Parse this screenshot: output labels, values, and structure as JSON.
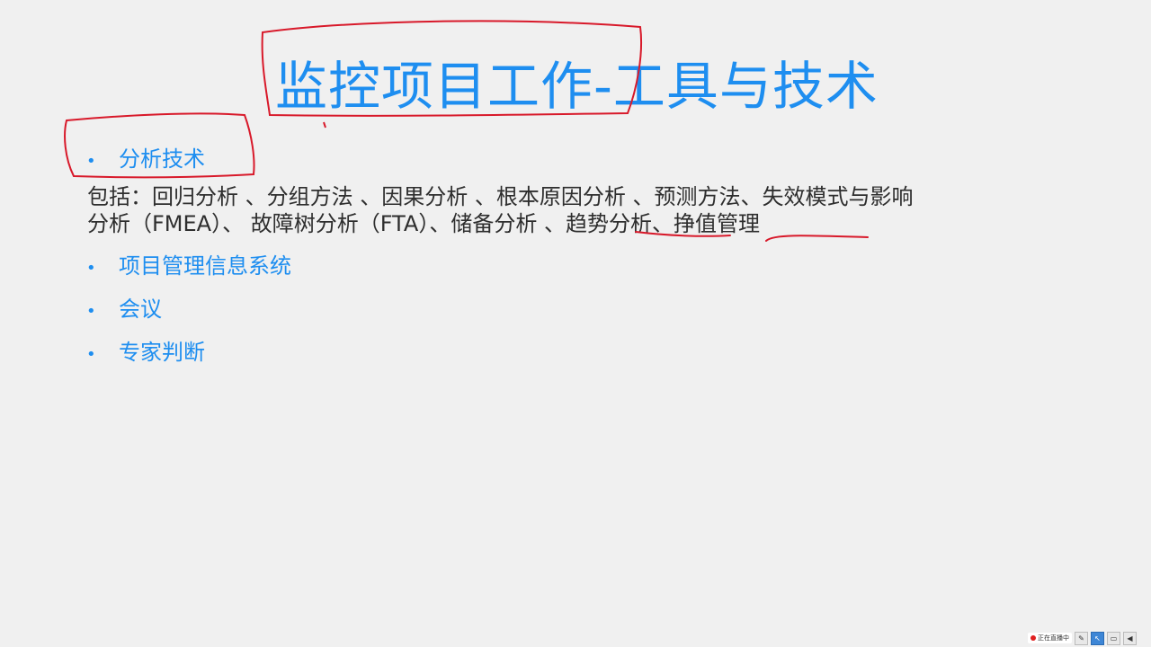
{
  "slide": {
    "title": "监控项目工作-工具与技术",
    "bullets": [
      {
        "marker": "•",
        "text": "分析技术"
      },
      {
        "marker": "•",
        "text": "项目管理信息系统"
      },
      {
        "marker": "•",
        "text": "会议"
      },
      {
        "marker": "•",
        "text": "专家判断"
      }
    ],
    "body_line1": "包括：回归分析 、分组方法 、因果分析 、根本原因分析 、预测方法、失效模式与影响",
    "body_line2": "分析（FMEA）、 故障树分析（FTA）、储备分析 、趋势分析、挣值管理"
  },
  "colors": {
    "accent": "#1e8ef0",
    "body_text": "#2e2e2e",
    "annotation": "#d8192a",
    "background": "#f0f0f0"
  },
  "taskbar": {
    "live_label": "正在直播中",
    "icons": [
      "pen-icon",
      "cursor-icon",
      "screen-icon",
      "speaker-icon"
    ]
  }
}
